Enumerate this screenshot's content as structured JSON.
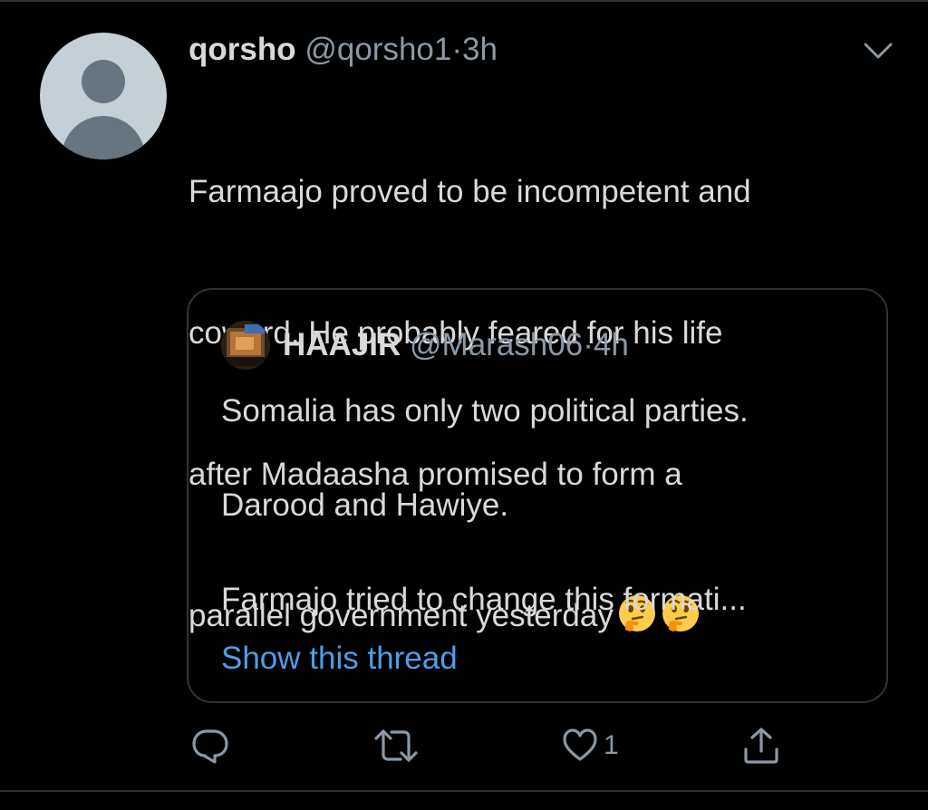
{
  "tweet": {
    "display_name": "qorsho",
    "handle": "@qorsho1",
    "separator": "·",
    "time": "3h",
    "text_lines": [
      "Farmaajo proved to be incompetent and",
      "coward. He probably feared for his life",
      "after Madaasha promised to form a",
      "parallel government yesterday"
    ],
    "trailing_emojis": [
      "thinking-face-emoji",
      "thinking-face-emoji"
    ]
  },
  "quoted_tweet": {
    "display_name": "HAAJIR",
    "handle": "@Marash06",
    "separator": "·",
    "time": "4h",
    "paragraphs": [
      "Somalia has only two political parties.",
      "Darood and Hawiye.",
      "Farmajo tried to change this formati..."
    ],
    "show_thread_label": "Show this thread"
  },
  "actions": {
    "reply_icon": "reply-icon",
    "retweet_icon": "retweet-icon",
    "like_icon": "heart-icon",
    "like_count": "1",
    "share_icon": "share-icon"
  },
  "colors": {
    "background": "#000000",
    "text": "#d9d9d9",
    "muted": "#8b98a5",
    "link": "#4c9ee9",
    "border": "#2f3336"
  }
}
